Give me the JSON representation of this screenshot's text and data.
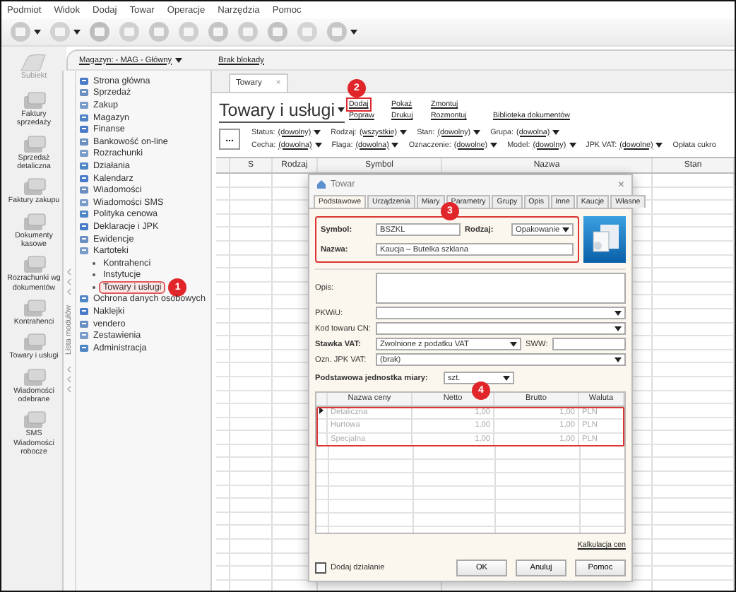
{
  "menu": [
    "Podmiot",
    "Widok",
    "Dodaj",
    "Towar",
    "Operacje",
    "Narzędzia",
    "Pomoc"
  ],
  "sidebar": {
    "logo": "Subiekt",
    "items": [
      "Faktury sprzedaży",
      "Sprzedaż detaliczna",
      "Faktury zakupu",
      "Dokumenty kasowe",
      "Rozrachunki wg dokumentów",
      "Kontrahenci",
      "Towary i usługi",
      "Wiadomości odebrane",
      "SMS Wiadomości robocze"
    ]
  },
  "location_bar": {
    "warehouse": "Magazyn: - MAG - Główny",
    "lock": "Brak blokady"
  },
  "modules": {
    "label": "Lista modułów",
    "items": [
      {
        "label": "Strona główna"
      },
      {
        "label": "Sprzedaż"
      },
      {
        "label": "Zakup"
      },
      {
        "label": "Magazyn"
      },
      {
        "label": "Finanse"
      },
      {
        "label": "Bankowość on-line"
      },
      {
        "label": "Rozrachunki"
      },
      {
        "label": "Działania"
      },
      {
        "label": "Kalendarz"
      },
      {
        "label": "Wiadomości"
      },
      {
        "label": "Wiadomości SMS"
      },
      {
        "label": "Polityka cenowa"
      },
      {
        "label": "Deklaracje i JPK"
      },
      {
        "label": "Ewidencje"
      },
      {
        "label": "Kartoteki",
        "children": [
          {
            "label": "Kontrahenci",
            "selected": false
          },
          {
            "label": "Instytucje",
            "selected": false
          },
          {
            "label": "Towary i usługi",
            "selected": true,
            "callout": "1"
          }
        ]
      },
      {
        "label": "Ochrona danych osobowych"
      },
      {
        "label": "Naklejki"
      },
      {
        "label": "vendero"
      },
      {
        "label": "Zestawienia"
      },
      {
        "label": "Administracja"
      }
    ]
  },
  "tabs": [
    {
      "label": "Towary",
      "selected": true,
      "close": "×"
    }
  ],
  "heading": "Towary i usługi",
  "actions": {
    "top": [
      {
        "label": "Dodaj",
        "callout": "2"
      },
      {
        "label": "Pokaż"
      },
      {
        "label": "Zmontuj"
      }
    ],
    "bottom": [
      {
        "label": "Popraw"
      },
      {
        "label": "Drukuj"
      },
      {
        "label": "Rozmontuj"
      },
      {
        "label": "Biblioteka dokumentów"
      }
    ]
  },
  "more_button": "...",
  "filters": [
    [
      {
        "label": "Status:",
        "value": "(dowolny)"
      },
      {
        "label": "Rodzaj:",
        "value": "(wszystkie)"
      },
      {
        "label": "Stan:",
        "value": "(dowolny)"
      },
      {
        "label": "Grupa:",
        "value": "(dowolna)"
      }
    ],
    [
      {
        "label": "Cecha:",
        "value": "(dowolna)"
      },
      {
        "label": "Flaga:",
        "value": "(dowolna)"
      },
      {
        "label": "Oznaczenie:",
        "value": "(dowolne)"
      },
      {
        "label": "Model:",
        "value": "(dowolny)"
      },
      {
        "label": "JPK VAT:",
        "value": "(dowolne)"
      },
      {
        "label": "Opłata cukro"
      }
    ]
  ],
  "table": {
    "columns": [
      "S",
      "Rodzaj",
      "Symbol",
      "Nazwa",
      "Stan"
    ]
  },
  "dialog": {
    "title": "Towar",
    "close": "×",
    "tabs": [
      {
        "label": "Podstawowe",
        "selected": true
      },
      {
        "label": "Urządzenia",
        "selected": false
      },
      {
        "label": "Miary",
        "selected": false
      },
      {
        "label": "Parametry",
        "selected": false
      },
      {
        "label": "Grupy",
        "selected": false
      },
      {
        "label": "Opis",
        "selected": false
      },
      {
        "label": "Inne",
        "selected": false
      },
      {
        "label": "Kaucje",
        "selected": false
      },
      {
        "label": "Własne",
        "selected": false
      }
    ],
    "main_fields": {
      "callout": "3",
      "symbol": {
        "label": "Symbol:",
        "value": "BSZKL"
      },
      "type": {
        "label": "Rodzaj:",
        "value": "Opakowanie"
      },
      "name": {
        "label": "Nazwa:",
        "value": "Kaucja – Butelka szklana"
      }
    },
    "fields": [
      {
        "kind": "textarea",
        "label": "Opis:",
        "required": false
      },
      {
        "kind": "select",
        "label": "PKWiU:",
        "required": false
      },
      {
        "kind": "select",
        "label": "Kod towaru CN:",
        "required": false
      },
      {
        "kind": "select_with_input",
        "label": "Stawka VAT:",
        "value": "Zwolnione z podatku VAT",
        "extra_label": "SWW:",
        "required": true
      },
      {
        "kind": "select",
        "label": "Ozn. JPK VAT:",
        "value": "(brak)",
        "required": false
      },
      {
        "kind": "unit",
        "label": "Podstawowa jednostka miary:",
        "value": "szt.",
        "required": true
      }
    ],
    "prices": {
      "callout": "4",
      "columns": [
        "Nazwa ceny",
        "Netto",
        "Brutto",
        "Waluta"
      ],
      "rows": [
        {
          "name": "Detaliczna",
          "net": "1,00",
          "gross": "1,00",
          "currency": "PLN",
          "selected": true,
          "disabled": true
        },
        {
          "name": "Hurtowa",
          "net": "1,00",
          "gross": "1,00",
          "currency": "PLN",
          "selected": false,
          "disabled": true
        },
        {
          "name": "Specjalna",
          "net": "1,00",
          "gross": "1,00",
          "currency": "PLN",
          "selected": false,
          "disabled": true
        }
      ]
    },
    "calc_link": "Kalkulacja cen",
    "add_action": {
      "label": "Dodaj działanie",
      "checked": false
    },
    "buttons": [
      "OK",
      "Anuluj",
      "Pomoc"
    ]
  }
}
